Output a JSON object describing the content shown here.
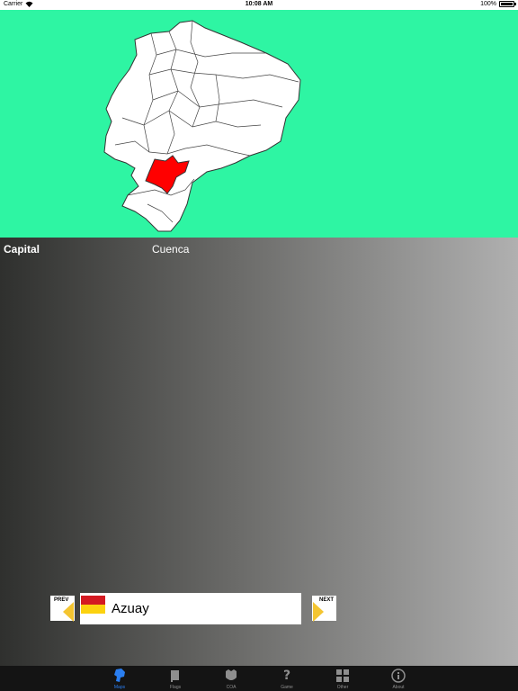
{
  "status_bar": {
    "carrier": "Carrier",
    "time": "10:08 AM",
    "battery": "100%"
  },
  "map": {
    "background_color": "#2ef5a3",
    "highlight_color": "#ff0000",
    "highlighted_region": "Azuay"
  },
  "info": {
    "capital_label": "Capital",
    "capital_value": "Cuenca"
  },
  "navigation": {
    "prev_label": "PREV",
    "next_label": "NEXT"
  },
  "region": {
    "name": "Azuay",
    "flag_colors": [
      "#d41a22",
      "#fcd20f"
    ]
  },
  "tabs": [
    {
      "label": "Maps",
      "icon": "map-icon",
      "active": true
    },
    {
      "label": "Flags",
      "icon": "flag-icon",
      "active": false
    },
    {
      "label": "COA",
      "icon": "coat-of-arms-icon",
      "active": false
    },
    {
      "label": "Game",
      "icon": "question-icon",
      "active": false
    },
    {
      "label": "Other",
      "icon": "grid-icon",
      "active": false
    },
    {
      "label": "About",
      "icon": "info-icon",
      "active": false
    }
  ]
}
